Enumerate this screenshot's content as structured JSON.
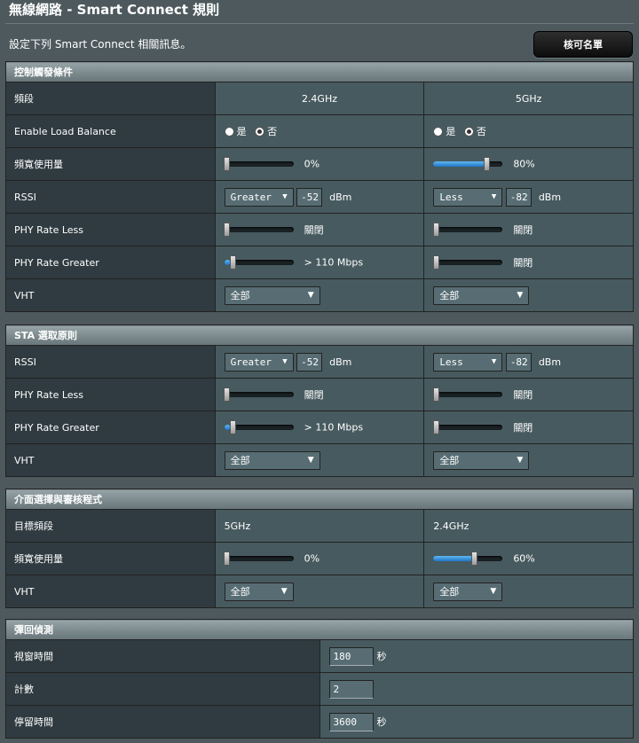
{
  "header": {
    "title": "無線網路 - Smart Connect 規則",
    "description": "設定下列 Smart Connect 相關訊息。",
    "approve_button": "核可名單"
  },
  "steering": {
    "title": "控制觸發條件",
    "band_label": "頻段",
    "band_24": "2.4GHz",
    "band_5": "5GHz",
    "load_balance_label": "Enable Load Balance",
    "yes": "是",
    "no": "否",
    "bw_label": "頻寬使用量",
    "bw_24": "0%",
    "bw_24_level": 0,
    "bw_5": "80%",
    "bw_5_level": 0.8,
    "rssi_label": "RSSI",
    "rssi_24_cmp": "Greater",
    "rssi_24_val": "-52",
    "rssi_5_cmp": "Less",
    "rssi_5_val": "-82",
    "dbm": "dBm",
    "phy_less_label": "PHY Rate Less",
    "phy_less_24": "關閉",
    "phy_less_5": "關閉",
    "phy_greater_label": "PHY Rate Greater",
    "phy_greater_24": "> 110 Mbps",
    "phy_greater_24_level": 0.1,
    "phy_greater_5": "關閉",
    "vht_label": "VHT",
    "vht_24": "全部",
    "vht_5": "全部"
  },
  "sta": {
    "title": "STA 選取原則",
    "rssi_label": "RSSI",
    "rssi_24_cmp": "Greater",
    "rssi_24_val": "-52",
    "rssi_5_cmp": "Less",
    "rssi_5_val": "-82",
    "dbm": "dBm",
    "phy_less_label": "PHY Rate Less",
    "phy_less_24": "關閉",
    "phy_less_5": "關閉",
    "phy_greater_label": "PHY Rate Greater",
    "phy_greater_24": "> 110 Mbps",
    "phy_greater_24_level": 0.1,
    "phy_greater_5": "關閉",
    "vht_label": "VHT",
    "vht_24": "全部",
    "vht_5": "全部"
  },
  "iface": {
    "title": "介面選擇與審核程式",
    "target_label": "目標頻段",
    "target_a": "5GHz",
    "target_b": "2.4GHz",
    "bw_label": "頻寬使用量",
    "bw_a": "0%",
    "bw_a_level": 0,
    "bw_b": "60%",
    "bw_b_level": 0.6,
    "vht_label": "VHT",
    "vht_a": "全部",
    "vht_b": "全部"
  },
  "bounce": {
    "title": "彈回偵測",
    "window_label": "視窗時間",
    "window_value": "180",
    "seconds": "秒",
    "count_label": "計數",
    "count_value": "2",
    "dwell_label": "停留時間",
    "dwell_value": "3600"
  }
}
